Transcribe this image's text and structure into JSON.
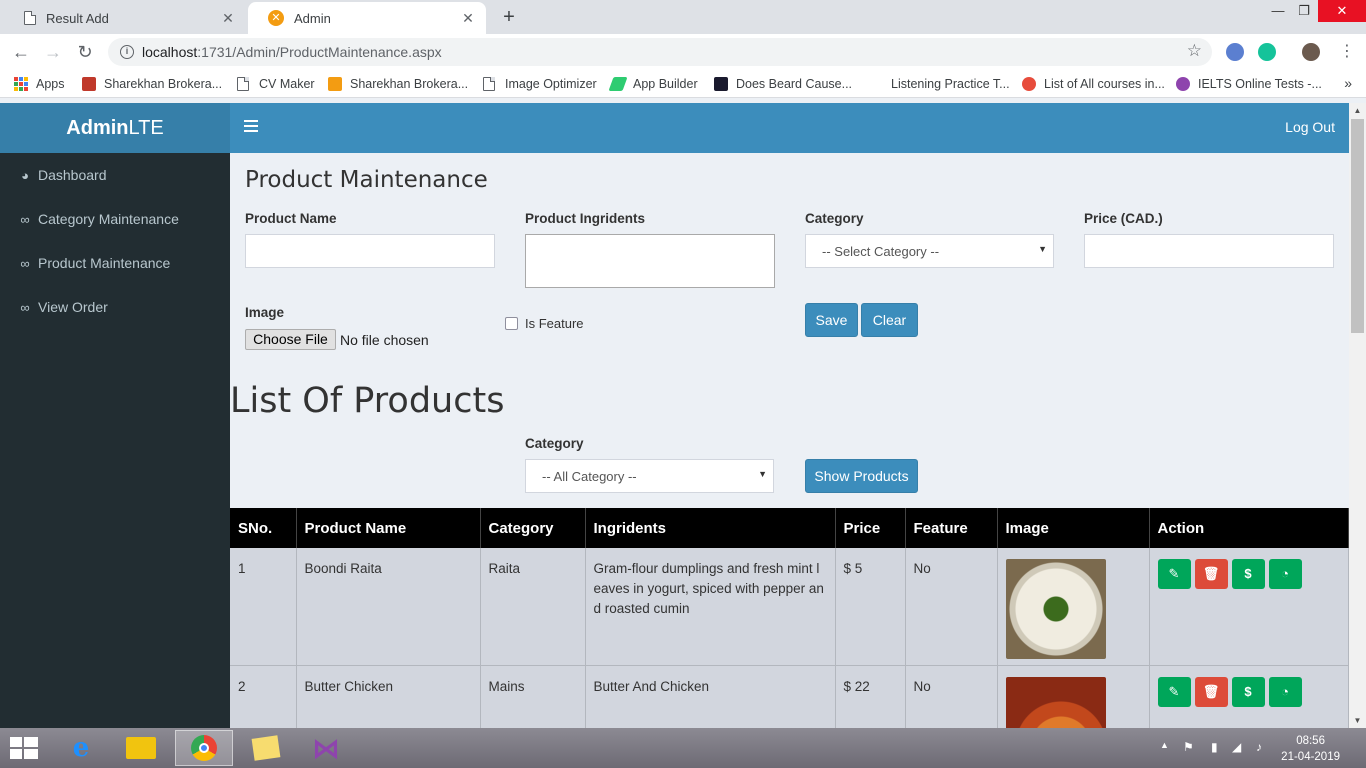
{
  "browser": {
    "tabs": [
      {
        "title": "Result Add",
        "active": false
      },
      {
        "title": "Admin",
        "active": true
      }
    ],
    "tab_close": "✕",
    "new_tab": "+",
    "window_controls": {
      "minimize": "—",
      "maximize": "❐",
      "close": "✕"
    },
    "url_host": "localhost",
    "url_path": ":1731/Admin/ProductMaintenance.aspx",
    "bookmarks": [
      "Apps",
      "Sharekhan Brokera...",
      "CV Maker",
      "Sharekhan Brokera...",
      "Image Optimizer",
      "App Builder",
      "Does Beard Cause...",
      "Listening Practice T...",
      "List of All courses in...",
      "IELTS Online Tests -..."
    ],
    "bookmarks_more": "»"
  },
  "app": {
    "logo_bold": "Admin",
    "logo_light": "LTE",
    "logout": "Log Out",
    "accent": "#3c8dbc",
    "sidebar_bg": "#222d32",
    "menu": [
      {
        "label": "Dashboard",
        "icon": "dashboard-icon"
      },
      {
        "label": "Category Maintenance",
        "icon": "link-icon"
      },
      {
        "label": "Product Maintenance",
        "icon": "link-icon"
      },
      {
        "label": "View Order",
        "icon": "link-icon"
      }
    ]
  },
  "form": {
    "title": "Product Maintenance",
    "product_name_label": "Product Name",
    "product_name_value": "",
    "ingredients_label": "Product Ingridents",
    "ingredients_value": "",
    "category_label": "Category",
    "category_selected": "-- Select Category --",
    "price_label": "Price (CAD.)",
    "price_value": "",
    "image_label": "Image",
    "choose_file": "Choose File",
    "no_file": "No file chosen",
    "is_feature_label": "Is Feature",
    "is_feature_checked": false,
    "save": "Save",
    "clear": "Clear"
  },
  "list": {
    "title": "List Of Products",
    "filter_label": "Category",
    "filter_selected": "-- All Category --",
    "show_button": "Show Products",
    "columns": [
      "SNo.",
      "Product Name",
      "Category",
      "Ingridents",
      "Price",
      "Feature",
      "Image",
      "Action"
    ],
    "rows": [
      {
        "sno": "1",
        "name": "Boondi Raita",
        "category": "Raita",
        "ingredients": "Gram-flour dumplings and fresh mint leaves in yogurt, spiced with pepper and roasted cumin",
        "price": "$ 5",
        "feature": "No"
      },
      {
        "sno": "2",
        "name": "Butter Chicken",
        "category": "Mains",
        "ingredients": "Butter And Chicken",
        "price": "$ 22",
        "feature": "No"
      }
    ],
    "action_icons": [
      "edit-icon",
      "trash-icon",
      "dollar-icon",
      "rss-icon"
    ]
  },
  "taskbar": {
    "time": "08:56",
    "date": "21-04-2019"
  }
}
